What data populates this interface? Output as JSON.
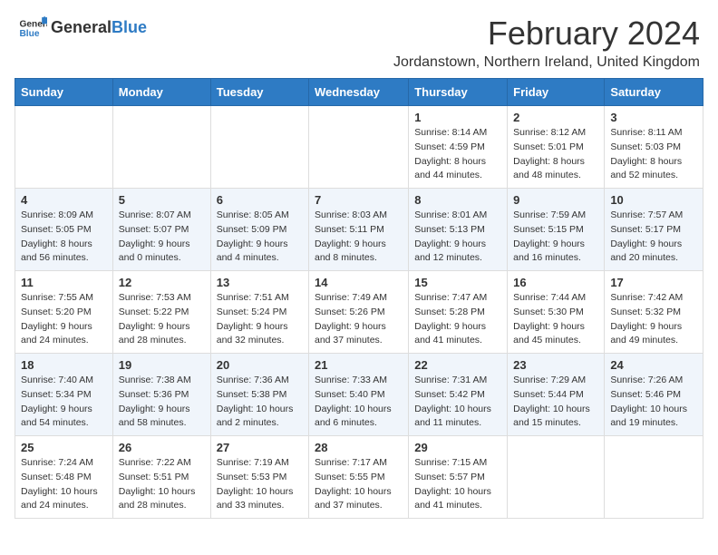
{
  "header": {
    "logo_general": "General",
    "logo_blue": "Blue",
    "title": "February 2024",
    "location": "Jordanstown, Northern Ireland, United Kingdom"
  },
  "days_of_week": [
    "Sunday",
    "Monday",
    "Tuesday",
    "Wednesday",
    "Thursday",
    "Friday",
    "Saturday"
  ],
  "weeks": [
    [
      {
        "day": "",
        "info": ""
      },
      {
        "day": "",
        "info": ""
      },
      {
        "day": "",
        "info": ""
      },
      {
        "day": "",
        "info": ""
      },
      {
        "day": "1",
        "info": "Sunrise: 8:14 AM\nSunset: 4:59 PM\nDaylight: 8 hours\nand 44 minutes."
      },
      {
        "day": "2",
        "info": "Sunrise: 8:12 AM\nSunset: 5:01 PM\nDaylight: 8 hours\nand 48 minutes."
      },
      {
        "day": "3",
        "info": "Sunrise: 8:11 AM\nSunset: 5:03 PM\nDaylight: 8 hours\nand 52 minutes."
      }
    ],
    [
      {
        "day": "4",
        "info": "Sunrise: 8:09 AM\nSunset: 5:05 PM\nDaylight: 8 hours\nand 56 minutes."
      },
      {
        "day": "5",
        "info": "Sunrise: 8:07 AM\nSunset: 5:07 PM\nDaylight: 9 hours\nand 0 minutes."
      },
      {
        "day": "6",
        "info": "Sunrise: 8:05 AM\nSunset: 5:09 PM\nDaylight: 9 hours\nand 4 minutes."
      },
      {
        "day": "7",
        "info": "Sunrise: 8:03 AM\nSunset: 5:11 PM\nDaylight: 9 hours\nand 8 minutes."
      },
      {
        "day": "8",
        "info": "Sunrise: 8:01 AM\nSunset: 5:13 PM\nDaylight: 9 hours\nand 12 minutes."
      },
      {
        "day": "9",
        "info": "Sunrise: 7:59 AM\nSunset: 5:15 PM\nDaylight: 9 hours\nand 16 minutes."
      },
      {
        "day": "10",
        "info": "Sunrise: 7:57 AM\nSunset: 5:17 PM\nDaylight: 9 hours\nand 20 minutes."
      }
    ],
    [
      {
        "day": "11",
        "info": "Sunrise: 7:55 AM\nSunset: 5:20 PM\nDaylight: 9 hours\nand 24 minutes."
      },
      {
        "day": "12",
        "info": "Sunrise: 7:53 AM\nSunset: 5:22 PM\nDaylight: 9 hours\nand 28 minutes."
      },
      {
        "day": "13",
        "info": "Sunrise: 7:51 AM\nSunset: 5:24 PM\nDaylight: 9 hours\nand 32 minutes."
      },
      {
        "day": "14",
        "info": "Sunrise: 7:49 AM\nSunset: 5:26 PM\nDaylight: 9 hours\nand 37 minutes."
      },
      {
        "day": "15",
        "info": "Sunrise: 7:47 AM\nSunset: 5:28 PM\nDaylight: 9 hours\nand 41 minutes."
      },
      {
        "day": "16",
        "info": "Sunrise: 7:44 AM\nSunset: 5:30 PM\nDaylight: 9 hours\nand 45 minutes."
      },
      {
        "day": "17",
        "info": "Sunrise: 7:42 AM\nSunset: 5:32 PM\nDaylight: 9 hours\nand 49 minutes."
      }
    ],
    [
      {
        "day": "18",
        "info": "Sunrise: 7:40 AM\nSunset: 5:34 PM\nDaylight: 9 hours\nand 54 minutes."
      },
      {
        "day": "19",
        "info": "Sunrise: 7:38 AM\nSunset: 5:36 PM\nDaylight: 9 hours\nand 58 minutes."
      },
      {
        "day": "20",
        "info": "Sunrise: 7:36 AM\nSunset: 5:38 PM\nDaylight: 10 hours\nand 2 minutes."
      },
      {
        "day": "21",
        "info": "Sunrise: 7:33 AM\nSunset: 5:40 PM\nDaylight: 10 hours\nand 6 minutes."
      },
      {
        "day": "22",
        "info": "Sunrise: 7:31 AM\nSunset: 5:42 PM\nDaylight: 10 hours\nand 11 minutes."
      },
      {
        "day": "23",
        "info": "Sunrise: 7:29 AM\nSunset: 5:44 PM\nDaylight: 10 hours\nand 15 minutes."
      },
      {
        "day": "24",
        "info": "Sunrise: 7:26 AM\nSunset: 5:46 PM\nDaylight: 10 hours\nand 19 minutes."
      }
    ],
    [
      {
        "day": "25",
        "info": "Sunrise: 7:24 AM\nSunset: 5:48 PM\nDaylight: 10 hours\nand 24 minutes."
      },
      {
        "day": "26",
        "info": "Sunrise: 7:22 AM\nSunset: 5:51 PM\nDaylight: 10 hours\nand 28 minutes."
      },
      {
        "day": "27",
        "info": "Sunrise: 7:19 AM\nSunset: 5:53 PM\nDaylight: 10 hours\nand 33 minutes."
      },
      {
        "day": "28",
        "info": "Sunrise: 7:17 AM\nSunset: 5:55 PM\nDaylight: 10 hours\nand 37 minutes."
      },
      {
        "day": "29",
        "info": "Sunrise: 7:15 AM\nSunset: 5:57 PM\nDaylight: 10 hours\nand 41 minutes."
      },
      {
        "day": "",
        "info": ""
      },
      {
        "day": "",
        "info": ""
      }
    ]
  ]
}
